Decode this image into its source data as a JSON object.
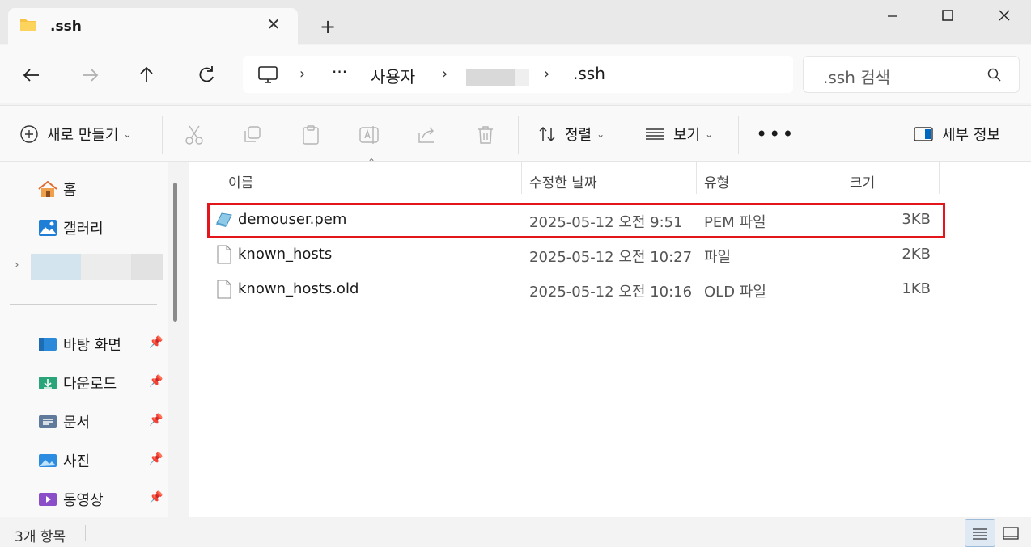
{
  "tab": {
    "title": ".ssh"
  },
  "address": {
    "ellipsis": "···",
    "seg1": "사용자",
    "current": ".ssh"
  },
  "search": {
    "placeholder": ".ssh 검색"
  },
  "toolbar": {
    "new_label": "새로 만들기",
    "sort_label": "정렬",
    "view_label": "보기",
    "details_label": "세부 정보"
  },
  "sidebar": {
    "items": [
      {
        "label": "홈",
        "icon": "home-icon"
      },
      {
        "label": "갤러리",
        "icon": "gallery-icon"
      }
    ],
    "pinned": [
      {
        "label": "바탕 화면",
        "icon": "desktop-folder-icon"
      },
      {
        "label": "다운로드",
        "icon": "downloads-folder-icon"
      },
      {
        "label": "문서",
        "icon": "documents-folder-icon"
      },
      {
        "label": "사진",
        "icon": "pictures-folder-icon"
      },
      {
        "label": "동영상",
        "icon": "videos-folder-icon"
      }
    ]
  },
  "columns": {
    "name": "이름",
    "modified": "수정한 날짜",
    "type": "유형",
    "size": "크기"
  },
  "files": [
    {
      "name": "demouser.pem",
      "modified": "2025-05-12 오전 9:51",
      "type": "PEM 파일",
      "size": "3KB",
      "icon": "certificate-file-icon"
    },
    {
      "name": "known_hosts",
      "modified": "2025-05-12 오전 10:27",
      "type": "파일",
      "size": "2KB",
      "icon": "generic-file-icon"
    },
    {
      "name": "known_hosts.old",
      "modified": "2025-05-12 오전 10:16",
      "type": "OLD 파일",
      "size": "1KB",
      "icon": "generic-file-icon"
    }
  ],
  "status": {
    "count": "3개 항목"
  },
  "colors": {
    "highlight": "#e3161b",
    "folder": "#f6c343",
    "accent": "#0067c0"
  }
}
